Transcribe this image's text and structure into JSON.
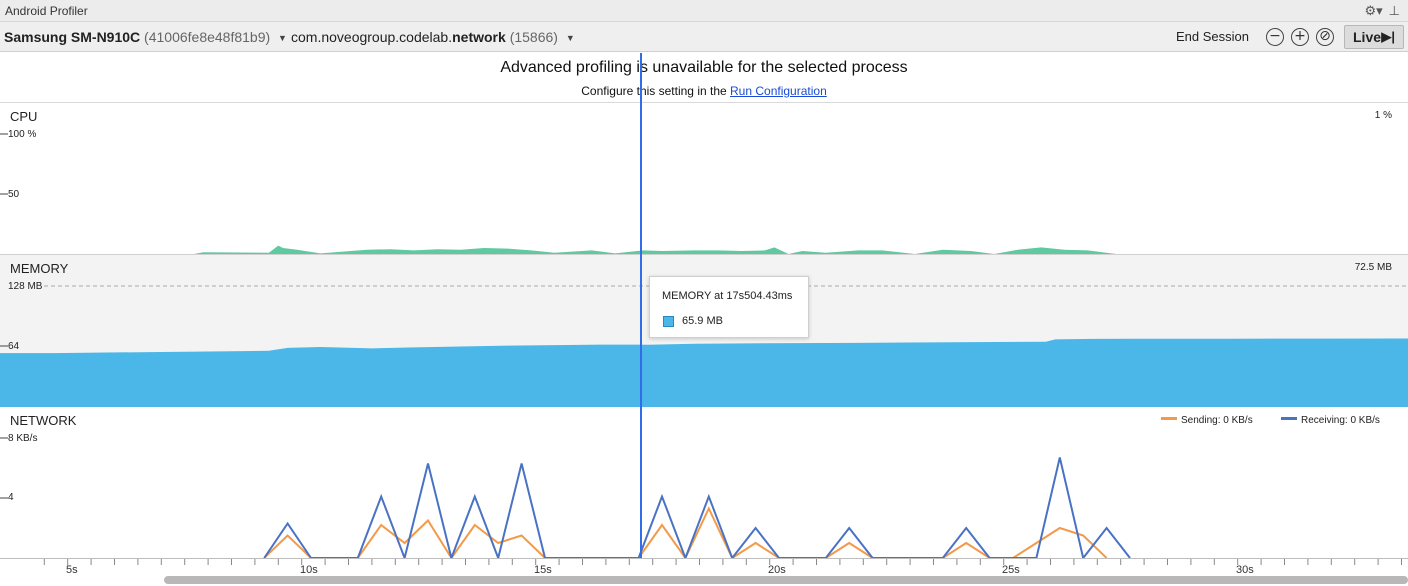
{
  "app": {
    "title": "Android Profiler"
  },
  "toolbar": {
    "device_name": "Samsung SM-N910C",
    "device_serial": "(41006fe8e48f81b9)",
    "process_prefix": "com.noveogroup.codelab.",
    "process_bold": "network",
    "process_pid": "(15866)",
    "end_session_label": "End Session",
    "live_label": "Live",
    "zoom_out_glyph": "−",
    "zoom_in_glyph": "+",
    "reset_zoom_glyph": "⊘"
  },
  "icons": {
    "gear": "gear-icon",
    "pin": "pin-icon",
    "dropdown": "chevron-down-icon",
    "zoom_out": "zoom-out-icon",
    "zoom_in": "zoom-in-icon",
    "reset_zoom": "reset-zoom-icon",
    "go_live": "go-live-icon"
  },
  "banner": {
    "headline": "Advanced profiling is unavailable for the selected process",
    "sub_prefix": "Configure this setting in the ",
    "link_text": "Run Configuration"
  },
  "cpu": {
    "label": "CPU",
    "current": "1 %",
    "tick_top": "100 %",
    "tick_mid": "50"
  },
  "memory": {
    "label": "MEMORY",
    "current": "72.5 MB",
    "tick_top": "128 MB",
    "tick_mid": "64"
  },
  "network": {
    "label": "NETWORK",
    "tick_top": "8 KB/s",
    "tick_mid": "4",
    "legend_sending": "Sending: 0 KB/s",
    "legend_receiving": "Receiving: 0 KB/s"
  },
  "tooltip": {
    "title": "MEMORY at 17s504.43ms",
    "value": "65.9 MB"
  },
  "colors": {
    "cpu_fill": "#5fc9a0",
    "memory_fill": "#4bb6e8",
    "sending": "#f29a4a",
    "receiving": "#4a72c4",
    "cursor": "#2f6ee8"
  },
  "chart_data": [
    {
      "type": "area",
      "series": [
        {
          "name": "CPU",
          "x": [
            7.8,
            8.0,
            9.4,
            9.6,
            9.7,
            10.0,
            10.5,
            11.5,
            12.0,
            12.5,
            13.0,
            13.5,
            14.0,
            14.5,
            15.0,
            15.5,
            16.3,
            16.8,
            17.4,
            17.8,
            18.5,
            19.0,
            19.5,
            20.0,
            20.2,
            20.5,
            20.8,
            21.3,
            22.0,
            22.5,
            23.2,
            23.8,
            24.4,
            24.9,
            25.4,
            25.9,
            26.4,
            26.9,
            27.5
          ],
          "y": [
            0,
            1.5,
            1,
            7,
            5,
            3.5,
            0.5,
            3.5,
            4,
            3,
            4,
            3.5,
            5,
            4.5,
            3,
            1,
            3,
            0.5,
            3,
            2.5,
            3,
            3,
            2.5,
            3,
            5.5,
            0,
            2.5,
            1,
            3,
            3,
            0,
            3.5,
            2.5,
            0,
            3.5,
            5.5,
            3.5,
            3,
            0
          ]
        }
      ],
      "ylim": [
        0,
        100
      ]
    },
    {
      "type": "area",
      "series": [
        {
          "name": "MEMORY",
          "x": [
            4.8,
            8.6,
            9.4,
            9.8,
            10.5,
            11.6,
            12.5,
            13.5,
            14.5,
            15.5,
            16.5,
            17.5,
            18.5,
            20.0,
            22.0,
            24.0,
            26.0,
            26.2,
            27.0,
            28.0,
            30.0,
            32.0,
            34.9
          ],
          "y": [
            57,
            59,
            59.5,
            62.5,
            63.5,
            62,
            63,
            64,
            65,
            65.5,
            66,
            65.9,
            67,
            67.5,
            67.8,
            68.5,
            69,
            71.5,
            72,
            72.2,
            72.3,
            72.4,
            72.5
          ]
        }
      ],
      "ylim": [
        0,
        128
      ]
    },
    {
      "type": "line",
      "series": [
        {
          "name": "Sending",
          "x": [
            9.3,
            9.8,
            10.3,
            11.3,
            11.8,
            12.3,
            12.8,
            13.3,
            13.8,
            14.3,
            14.8,
            15.3,
            17.3,
            17.8,
            18.3,
            18.8,
            19.3,
            19.8,
            20.3,
            21.3,
            21.8,
            22.3,
            23.8,
            24.3,
            24.8,
            25.3,
            25.8,
            26.3,
            26.8,
            27.3
          ],
          "y": [
            0,
            1.5,
            0,
            0,
            2.2,
            1,
            2.5,
            0,
            2.2,
            1,
            1.5,
            0,
            0,
            2.2,
            0,
            3.3,
            0,
            1,
            0,
            0,
            1,
            0,
            0,
            1,
            0,
            0,
            1,
            2,
            1.5,
            0
          ]
        },
        {
          "name": "Receiving",
          "x": [
            9.3,
            9.8,
            10.3,
            11.3,
            11.8,
            12.3,
            12.8,
            13.3,
            13.8,
            14.3,
            14.8,
            15.3,
            17.3,
            17.8,
            18.3,
            18.8,
            19.3,
            19.8,
            20.3,
            21.3,
            21.8,
            22.3,
            23.8,
            24.3,
            24.8,
            25.8,
            26.3,
            26.8,
            27.3,
            27.8
          ],
          "y": [
            0,
            2.3,
            0,
            0,
            4.1,
            0,
            6.3,
            0,
            4.1,
            0,
            6.3,
            0,
            0,
            4.1,
            0,
            4.1,
            0,
            2,
            0,
            0,
            2,
            0,
            0,
            2,
            0,
            0,
            6.7,
            0,
            2,
            0
          ]
        }
      ],
      "ylim": [
        0,
        8
      ]
    }
  ],
  "time_axis": {
    "labels": [
      "5s",
      "10s",
      "15s",
      "20s",
      "25s",
      "30s"
    ],
    "values": [
      5,
      10,
      15,
      20,
      25,
      30
    ]
  }
}
